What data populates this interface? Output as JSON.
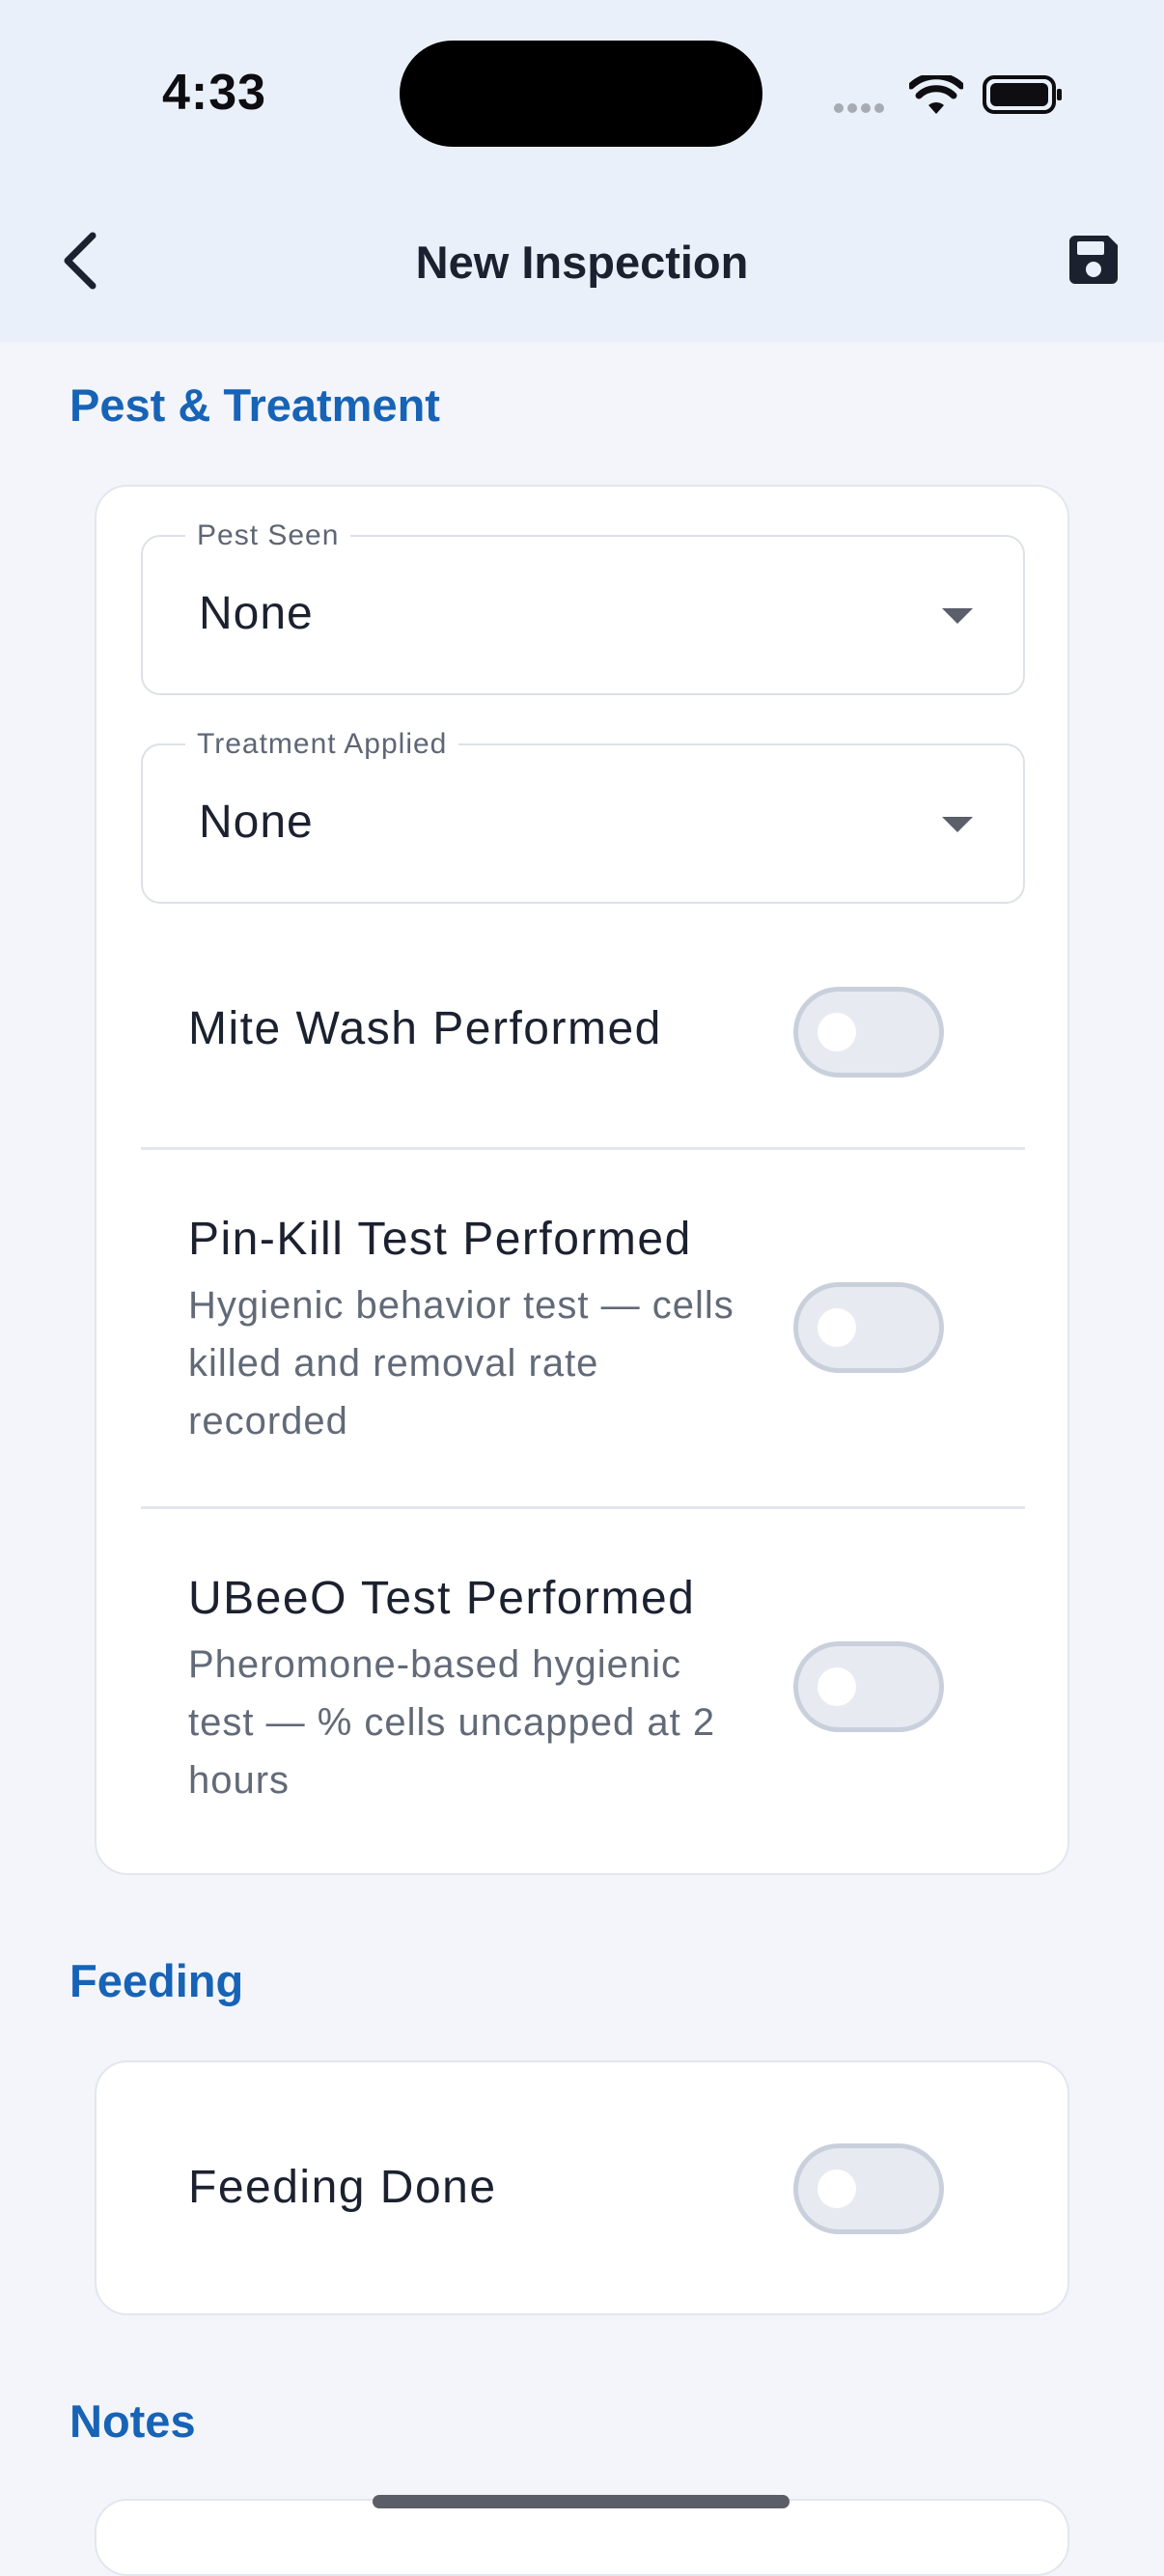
{
  "status_bar": {
    "time": "4:33"
  },
  "header": {
    "title": "New Inspection"
  },
  "colors": {
    "accent": "#1763b6",
    "header_bg": "#eaf0f9",
    "page_bg": "#f3f5fa"
  },
  "sections": {
    "pest": {
      "heading": "Pest & Treatment",
      "pest_seen": {
        "label": "Pest Seen",
        "value": "None"
      },
      "treatment": {
        "label": "Treatment Applied",
        "value": "None"
      },
      "mite_wash": {
        "title": "Mite Wash Performed",
        "on": false
      },
      "pin_kill": {
        "title": "Pin-Kill Test Performed",
        "subtitle": "Hygienic behavior test — cells killed and removal rate recorded",
        "on": false
      },
      "ubeeo": {
        "title": "UBeeO Test Performed",
        "subtitle": "Pheromone-based hygienic test — % cells uncapped at 2 hours",
        "on": false
      }
    },
    "feeding": {
      "heading": "Feeding",
      "feeding_done": {
        "title": "Feeding Done",
        "on": false
      }
    },
    "notes": {
      "heading": "Notes"
    }
  }
}
